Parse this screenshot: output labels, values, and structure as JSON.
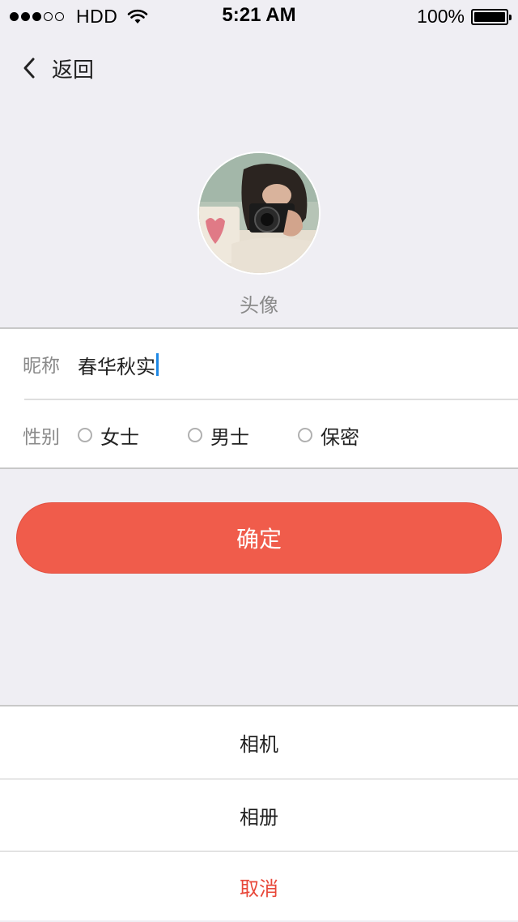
{
  "status_bar": {
    "carrier": "HDD",
    "signal_dots_filled": 3,
    "signal_dots_total": 5,
    "time": "5:21 AM",
    "battery_percent": "100%",
    "battery_level": 1.0,
    "icons": [
      "signal-dots-icon",
      "wifi-icon",
      "battery-icon"
    ]
  },
  "nav": {
    "back_label": "返回",
    "back_icon": "chevron-left-icon"
  },
  "profile": {
    "avatar_label": "头像"
  },
  "form": {
    "nickname_label": "昵称",
    "nickname_value": "春华秋实",
    "gender_label": "性别",
    "gender_options": [
      {
        "label": "女士",
        "selected": false
      },
      {
        "label": "男士",
        "selected": false
      },
      {
        "label": "保密",
        "selected": false
      }
    ]
  },
  "confirm_label": "确定",
  "action_sheet": {
    "items": [
      {
        "label": "相机"
      },
      {
        "label": "相册"
      },
      {
        "label": "取消"
      }
    ]
  },
  "colors": {
    "accent": "#f05c4b",
    "cancel": "#e8483a",
    "caret": "#1e88e5",
    "background": "#efeef3"
  }
}
